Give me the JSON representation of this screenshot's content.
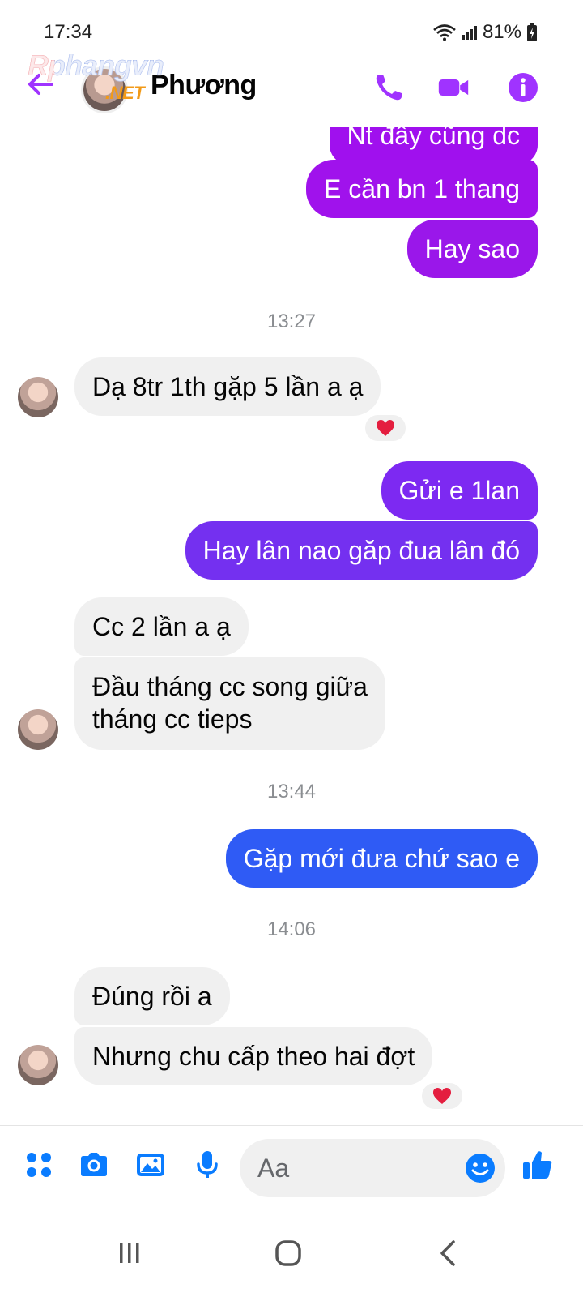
{
  "status_bar": {
    "time": "17:34",
    "battery": "81%"
  },
  "header": {
    "contact_name": "Phương",
    "watermark_top": "Rphangvn",
    "watermark_bottom": ".NET"
  },
  "messages": {
    "m1": "Nt đây cũng dc",
    "m2": "E cần bn 1 thang",
    "m3": "Hay sao",
    "ts1": "13:27",
    "m4": "Dạ 8tr 1th gặp 5 lần a ạ",
    "m5": "Gửi e 1lan",
    "m6": "Hay lân nao găp đua lân đó",
    "m7": "Cc 2 lần a ạ",
    "m8_line1": "Đầu tháng cc song giữa",
    "m8_line2": "tháng cc tieps",
    "ts2": "13:44",
    "m9": "Gặp mới đưa chứ sao e",
    "ts3": "14:06",
    "m10": "Đúng rồi a",
    "m11": "Nhưng chu cấp theo hai đợt"
  },
  "composer": {
    "placeholder": "Aa"
  },
  "colors": {
    "accent": "#a033ff",
    "bubble_purple": "#a010ee",
    "bubble_violet": "#7a2ff2",
    "bubble_blue": "#2f5bf5",
    "icon_blue": "#0a7cff",
    "incoming_bg": "#f0f0f0",
    "reaction": "#e41e3f"
  },
  "icons": {
    "back": "arrow-left-icon",
    "call": "phone-icon",
    "video": "video-camera-icon",
    "info": "info-icon",
    "reaction": "heart-icon",
    "menu": "four-dots-icon",
    "camera": "camera-icon",
    "gallery": "image-icon",
    "mic": "microphone-icon",
    "emoji": "smiley-icon",
    "like": "thumbs-up-icon"
  }
}
